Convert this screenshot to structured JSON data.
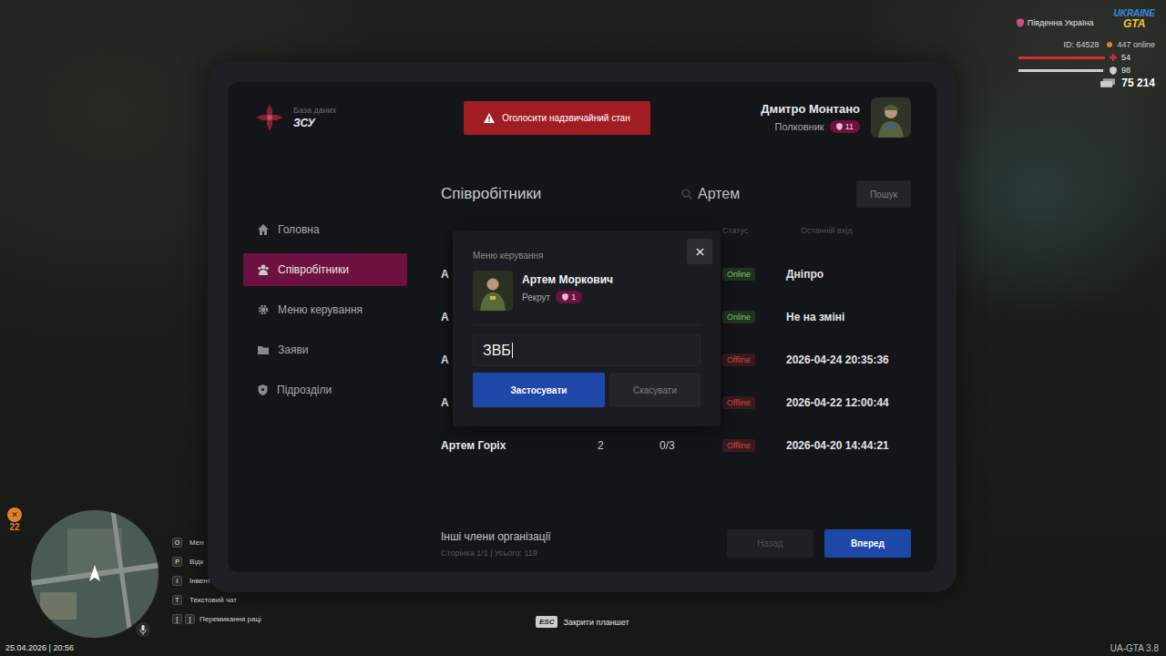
{
  "hud": {
    "region": "Південна Україна",
    "logo": {
      "top": "UKRAINE",
      "bottom": "GTA"
    },
    "player_id": "ID: 64528",
    "online": "447 online",
    "health": {
      "value": "54",
      "level": 1
    },
    "armor": {
      "value": "98",
      "level": 0.98
    },
    "money": "75 214"
  },
  "tablet": {
    "brand": {
      "subtitle": "База даних",
      "title": "ЗСУ"
    },
    "emergency_button": "Оголосити надзвичайний стан",
    "user": {
      "name": "Дмитро Монтано",
      "rank": "Полковник",
      "badge": "11"
    },
    "sidebar": {
      "items": [
        {
          "label": "Головна",
          "selected": false
        },
        {
          "label": "Співробітники",
          "selected": true
        },
        {
          "label": "Меню керування",
          "selected": false
        },
        {
          "label": "Заяви",
          "selected": false
        },
        {
          "label": "Підрозділи",
          "selected": false
        }
      ]
    },
    "page_title": "Співробітники",
    "search": {
      "value": "Артем",
      "button": "Пошук"
    },
    "table": {
      "columns": [
        "Статус",
        "Останній вхід"
      ],
      "rows": [
        {
          "name": "А",
          "status": "Online",
          "online": true,
          "last": "Дніпро"
        },
        {
          "name": "А",
          "status": "Online",
          "online": true,
          "last": "Не на зміні"
        },
        {
          "name": "А",
          "status": "Offline",
          "online": false,
          "last": "2026-04-24 20:35:36"
        },
        {
          "name": "А",
          "status": "Offline",
          "online": false,
          "last": "2026-04-22 12:00:44"
        },
        {
          "name": "Артем Горіх",
          "rank": "2",
          "warnings": "0/3",
          "status": "Offline",
          "online": false,
          "last": "2026-04-20 14:44:21"
        }
      ]
    },
    "footer": {
      "title": "Інші члени організації",
      "info": "Сторінка 1/1 | Усього: 119",
      "prev": {
        "label": "Назад",
        "disabled": true
      },
      "next": {
        "label": "Вперед",
        "disabled": false
      }
    }
  },
  "modal": {
    "title": "Меню керування",
    "member": {
      "name": "Артем Моркович",
      "rank": "Рекрут",
      "badge": "1"
    },
    "input": {
      "value": "ЗВБ",
      "focused": true
    },
    "apply": "Застосувати",
    "cancel": "Скасувати"
  },
  "hints": [
    {
      "keys": [
        "O"
      ],
      "label": "Мен"
    },
    {
      "keys": [
        "P"
      ],
      "label": "Відк"
    },
    {
      "keys": [
        "I"
      ],
      "label": "Інвент"
    },
    {
      "keys": [
        "T"
      ],
      "label": "Текстовий чат"
    },
    {
      "keys": [
        "[",
        "]"
      ],
      "label": "Перемикання раці"
    }
  ],
  "close_hint": {
    "key": "ESC",
    "label": "Закрити планшет"
  },
  "minimap": {
    "badge": "22"
  },
  "datetime": "25.04.2026 | 20:56",
  "version": "UA-GTA 3.8"
}
